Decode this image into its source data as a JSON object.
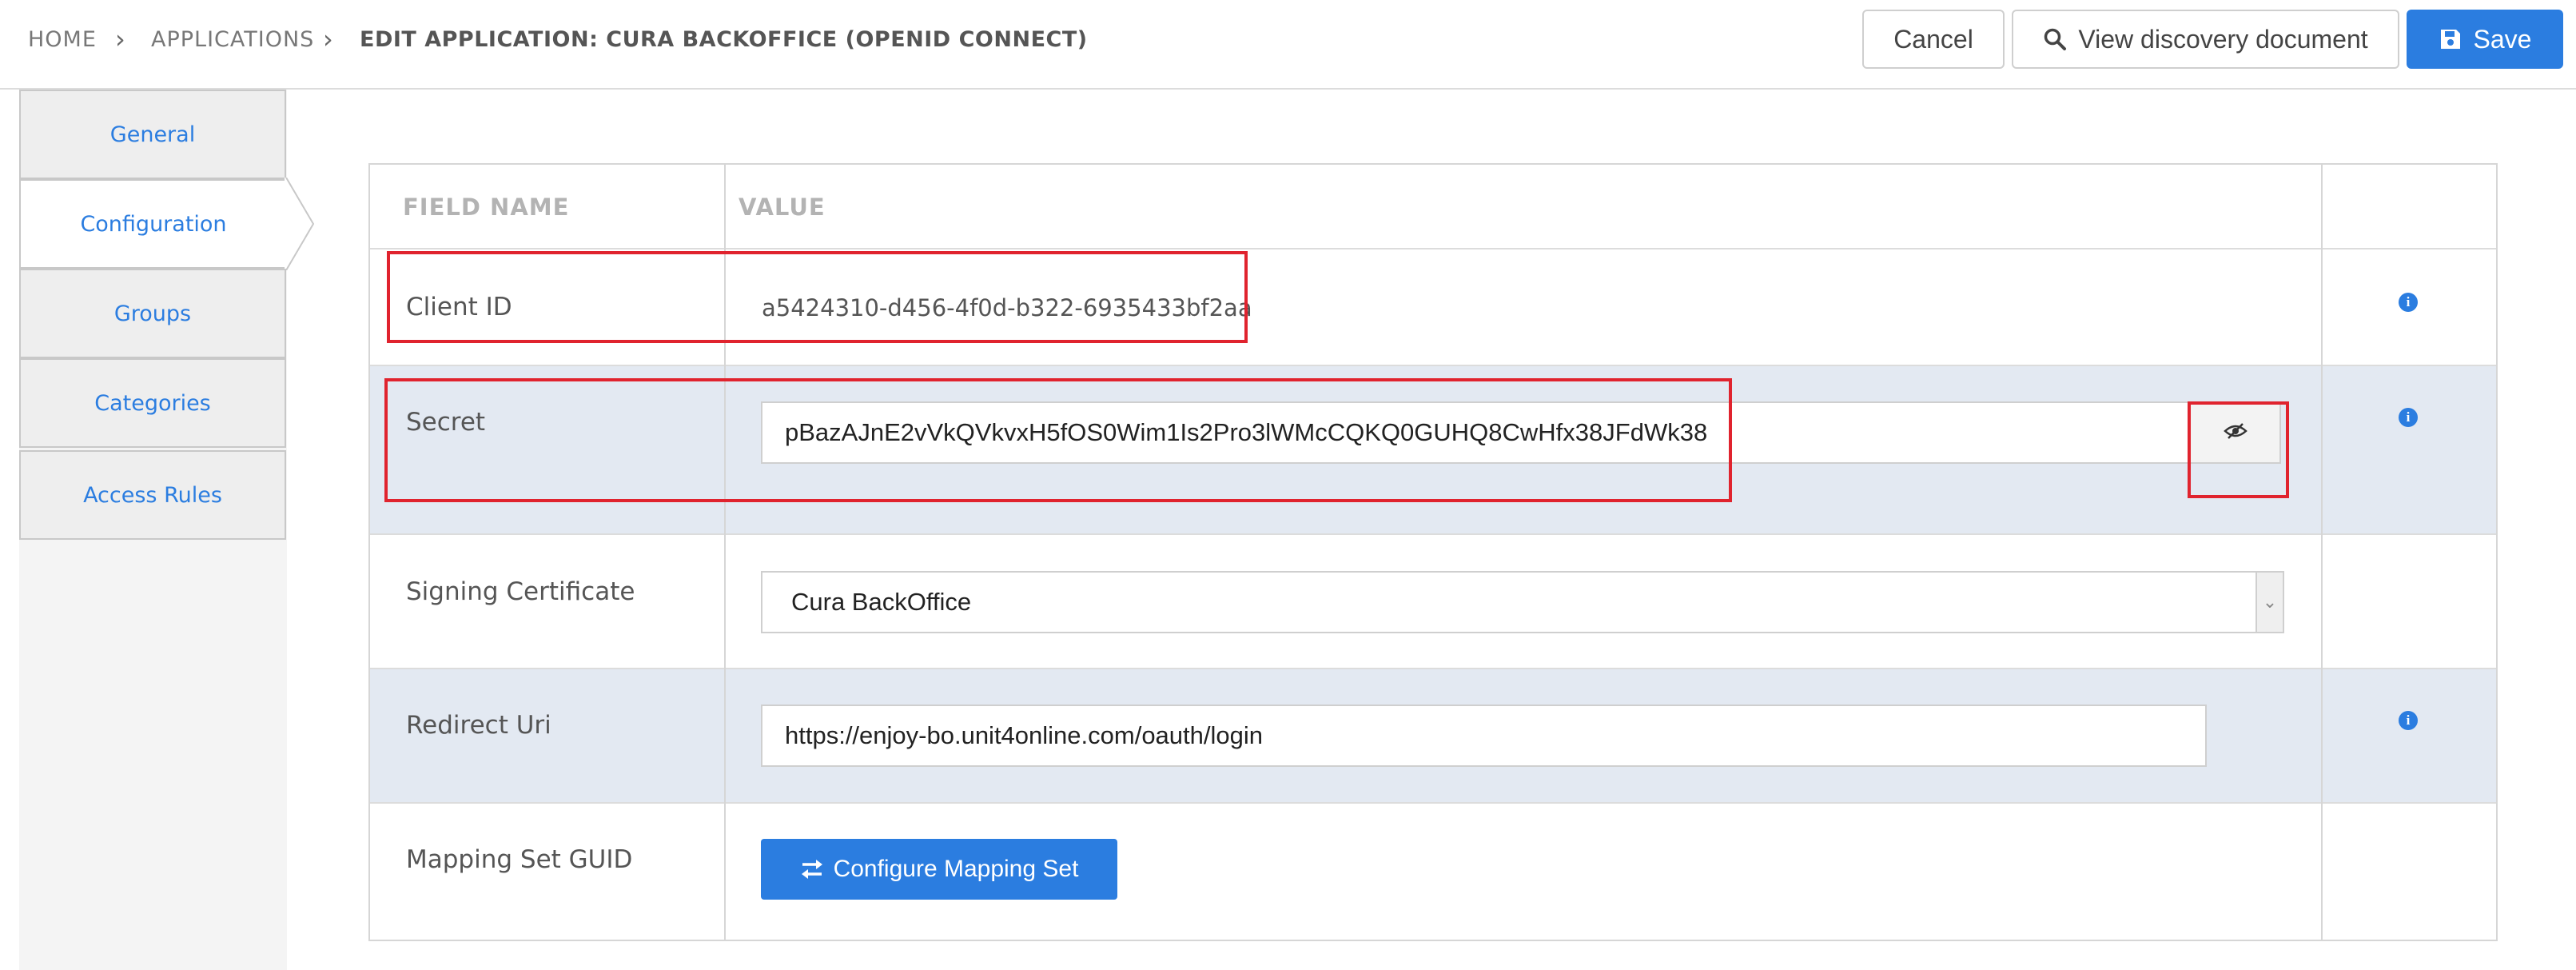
{
  "breadcrumb": {
    "home": "HOME",
    "applications": "APPLICATIONS",
    "current": "EDIT APPLICATION: CURA BACKOFFICE (OPENID CONNECT)"
  },
  "toolbar": {
    "cancel_label": "Cancel",
    "discovery_label": "View discovery document",
    "save_label": "Save"
  },
  "tabs": [
    {
      "label": "General",
      "active": false
    },
    {
      "label": "Configuration",
      "active": true
    },
    {
      "label": "Groups",
      "active": false
    },
    {
      "label": "Categories",
      "active": false
    },
    {
      "label": "Access Rules",
      "active": false
    }
  ],
  "table": {
    "headers": {
      "field": "FIELD NAME",
      "value": "VALUE"
    },
    "client_id": {
      "label": "Client ID",
      "value": "a5424310-d456-4f0d-b322-6935433bf2aa"
    },
    "secret": {
      "label": "Secret",
      "value": "pBazAJnE2vVkQVkvxH5fOS0Wim1Is2Pro3lWMcCQKQ0GUHQ8CwHfx38JFdWk38"
    },
    "signing_certificate": {
      "label": "Signing Certificate",
      "value": "Cura BackOffice"
    },
    "redirect_uri": {
      "label": "Redirect Uri",
      "value": "https://enjoy-bo.unit4online.com/oauth/login"
    },
    "mapping_set": {
      "label": "Mapping Set GUID",
      "button_label": "Configure Mapping Set"
    }
  },
  "icons": {
    "search": "search-icon",
    "save": "floppy-disk-icon",
    "eye": "eye-slash-icon",
    "info": "info-circle-icon",
    "exchange": "exchange-arrows-icon"
  },
  "colors": {
    "accent": "#2b7de0",
    "highlight": "#e0232e",
    "alt_row": "#e3e9f2"
  }
}
